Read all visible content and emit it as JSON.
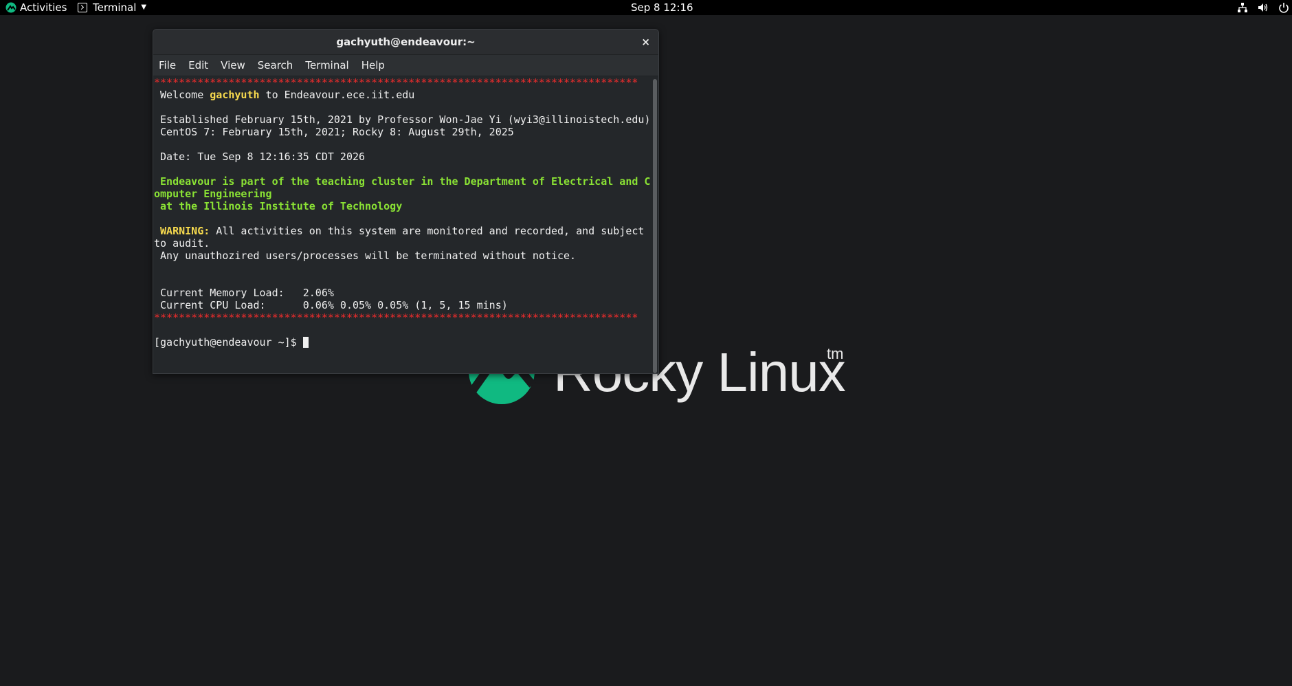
{
  "topbar": {
    "activities_label": "Activities",
    "app_menu_label": "Terminal",
    "clock": "Sep 8  12:16",
    "icons": [
      "network-icon",
      "volume-icon",
      "power-icon"
    ]
  },
  "wallpaper": {
    "logo_text": "Rocky Linux",
    "tm": "tm",
    "brand_color": "#10b981"
  },
  "window": {
    "title": "gachyuth@endeavour:~",
    "close_glyph": "×",
    "menu": [
      "File",
      "Edit",
      "View",
      "Search",
      "Terminal",
      "Help"
    ]
  },
  "terminal": {
    "stars": "******************************************************************************",
    "welcome_pre": " Welcome ",
    "welcome_user": "gachyuth",
    "welcome_post": " to Endeavour.ece.iit.edu",
    "established": " Established February 15th, 2021 by Professor Won-Jae Yi (wyi3@illinoistech.edu)",
    "os_dates": " CentOS 7: February 15th, 2021; Rocky 8: August 29th, 2025",
    "date_line": " Date: Tue Sep 8 12:16:35 CDT 2026",
    "dept_line1": " Endeavour is part of the teaching cluster in the Department of Electrical and C",
    "dept_line2": "omputer Engineering",
    "dept_line3": " at the Illinois Institute of Technology",
    "warning_label": "WARNING:",
    "warning_text1": " All activities on this system are monitored and recorded, and subject",
    "warning_text2": "to audit.",
    "unauth_line": " Any unauthozired users/processes will be terminated without notice.",
    "mem_line": " Current Memory Load:   2.06%",
    "cpu_line": " Current CPU Load:      0.06% 0.05% 0.05% (1, 5, 15 mins)",
    "prompt": "[gachyuth@endeavour ~]$ "
  },
  "colors": {
    "stars": "#ee2c2c",
    "username": "#f7da4e",
    "dept": "#8ae234"
  }
}
